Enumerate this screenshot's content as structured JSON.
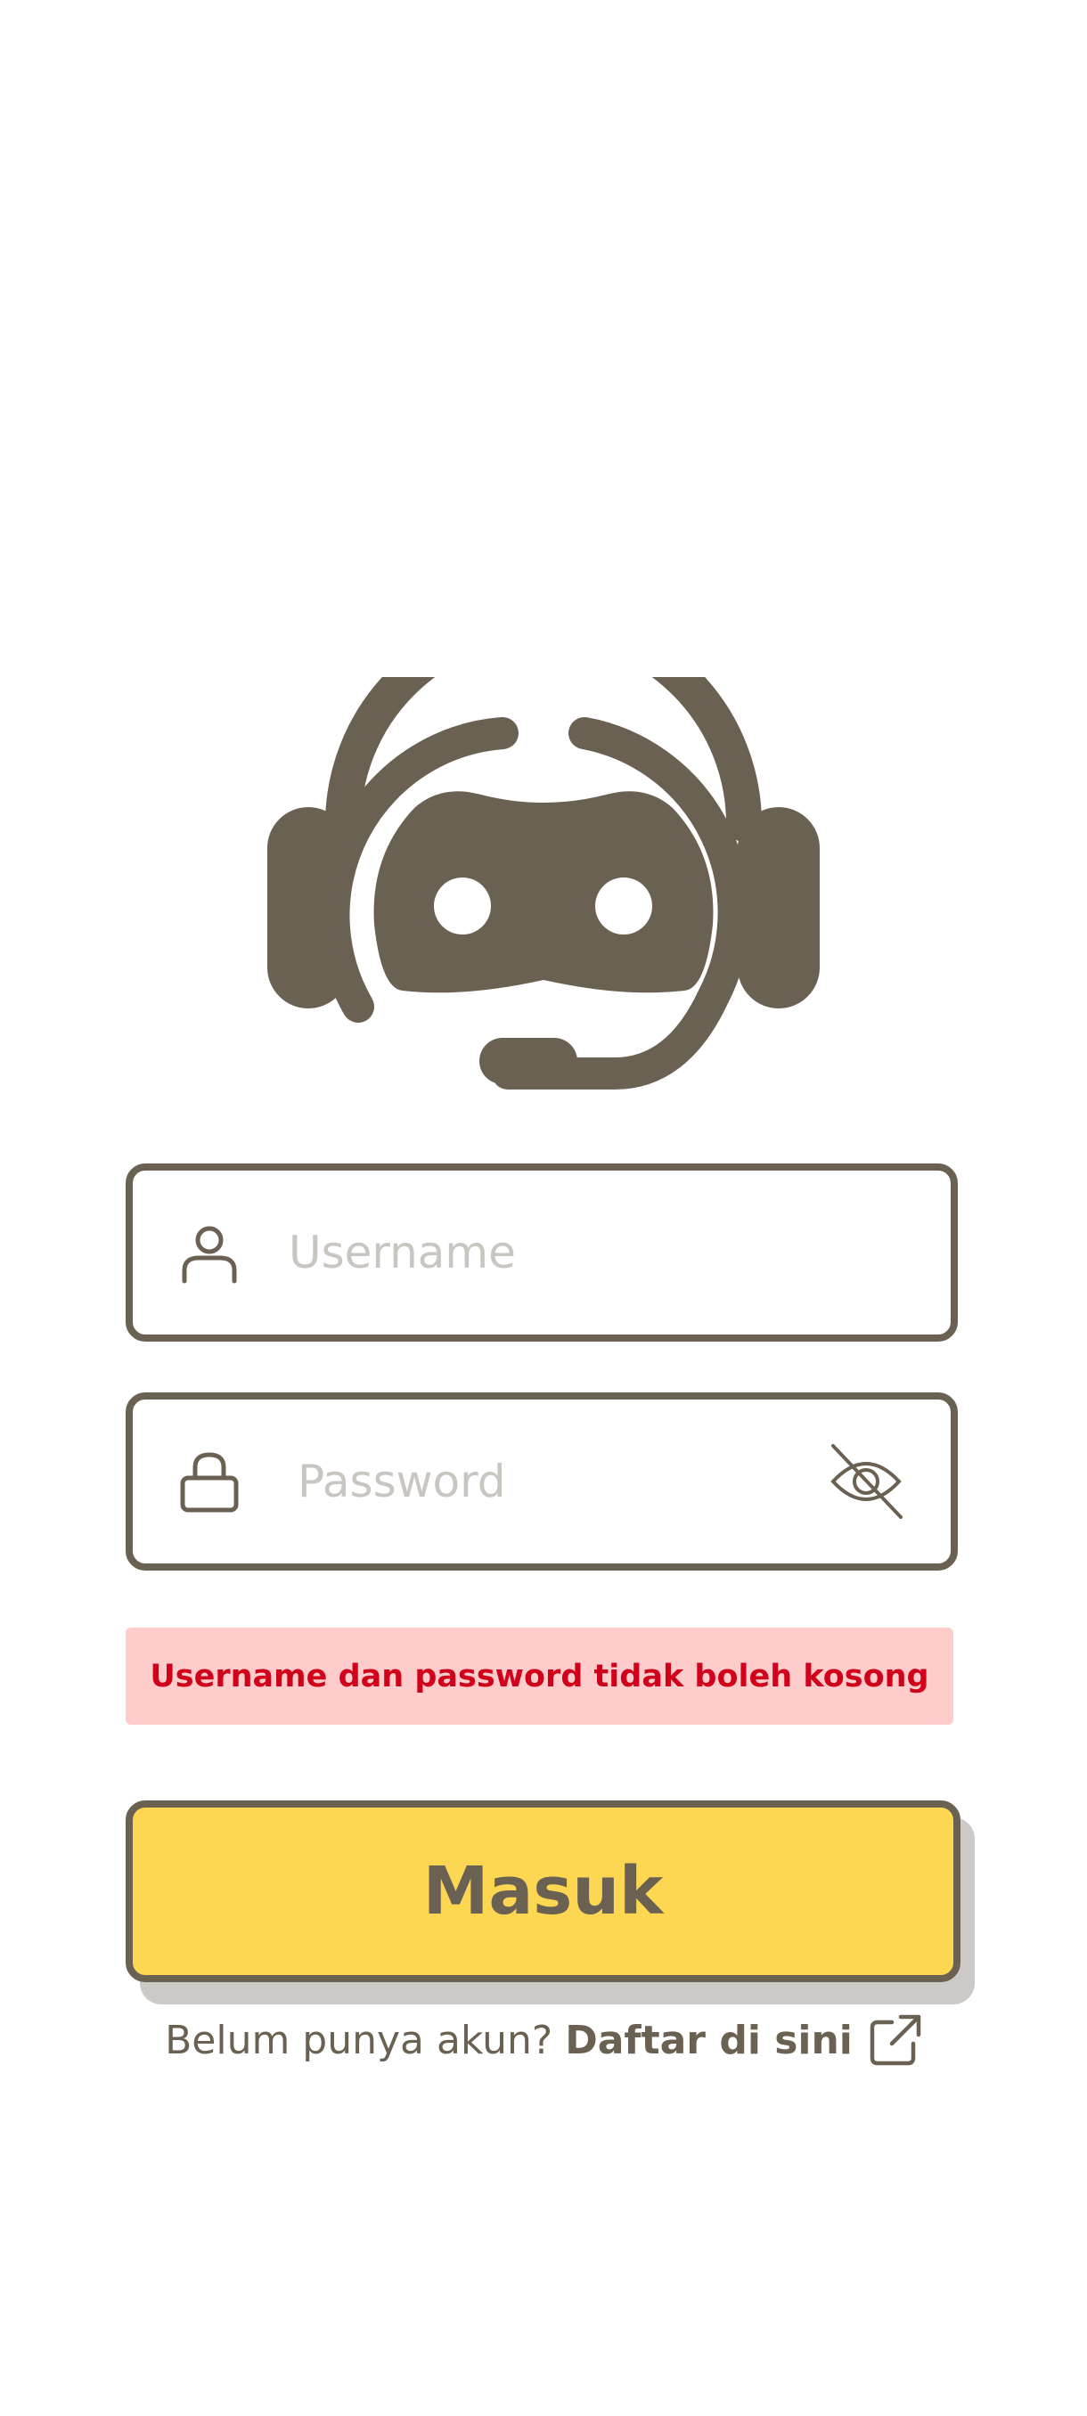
{
  "logo": {
    "icon": "support-bot-headset-icon"
  },
  "username": {
    "placeholder": "Username",
    "value": "",
    "icon": "user-icon"
  },
  "password": {
    "placeholder": "Password",
    "value": "",
    "icon": "lock-icon",
    "toggle_icon": "eye-off-icon"
  },
  "error": {
    "message": "Username dan password tidak boleh kosong"
  },
  "login_button": {
    "label": "Masuk"
  },
  "register": {
    "prompt": "Belum punya akun?",
    "link": "Daftar di sini",
    "icon": "external-link-icon"
  },
  "colors": {
    "primary": "#6b6153",
    "accent_yellow": "#fed752",
    "error_bg": "#ffcccc",
    "error_text": "#d0021b",
    "placeholder": "#c9c6c2"
  }
}
